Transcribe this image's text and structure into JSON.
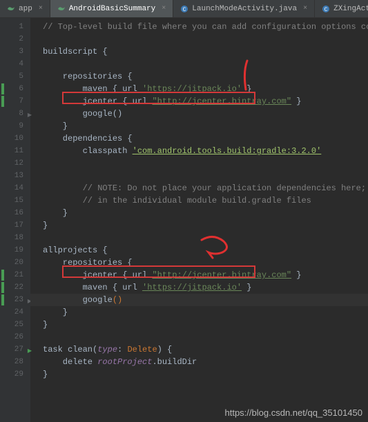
{
  "tabs": [
    {
      "label": "app",
      "active": false
    },
    {
      "label": "AndroidBasicSummary",
      "active": true
    },
    {
      "label": "LaunchModeActivity.java",
      "active": false
    },
    {
      "label": "ZXingActi",
      "active": false
    }
  ],
  "code": {
    "l1": "// Top-level build file where you can add configuration options common to all",
    "l3": "buildscript {",
    "l5": "    repositories {",
    "l6a": "        maven { url ",
    "l6b": "'https://jitpack.io'",
    "l6c": " }",
    "l7a": "        jcenter { url ",
    "l7b": "\"http://jcenter.bintray.com\"",
    "l7c": " }",
    "l8": "        google()",
    "l9": "    }",
    "l10": "    dependencies {",
    "l11a": "        classpath ",
    "l11b": "'com.android.tools.build:gradle:3.2.0'",
    "l14": "        // NOTE: Do not place your application dependencies here; they belong",
    "l15": "        // in the individual module build.gradle files",
    "l16": "    }",
    "l17": "}",
    "l19": "allprojects {",
    "l20": "    repositories {",
    "l21a": "        jcenter { url ",
    "l21b": "\"http://jcenter.bintray.com\"",
    "l21c": " }",
    "l22a": "        maven { url ",
    "l22b": "'https://jitpack.io'",
    "l22c": " }",
    "l23a": "        google",
    "l23b": "()",
    "l24": "    }",
    "l25": "}",
    "l27a": "task clean(",
    "l27b": "type",
    "l27c": ": ",
    "l27d": "Delete",
    "l27e": ") {",
    "l28a": "    delete ",
    "l28b": "rootProject",
    "l28c": ".buildDir",
    "l29": "}"
  },
  "lineNumbers": [
    "1",
    "2",
    "3",
    "4",
    "5",
    "6",
    "7",
    "8",
    "9",
    "10",
    "11",
    "12",
    "13",
    "14",
    "15",
    "16",
    "17",
    "18",
    "19",
    "20",
    "21",
    "22",
    "23",
    "24",
    "25",
    "26",
    "27",
    "28",
    "29"
  ],
  "watermark": "https://blog.csdn.net/qq_35101450"
}
